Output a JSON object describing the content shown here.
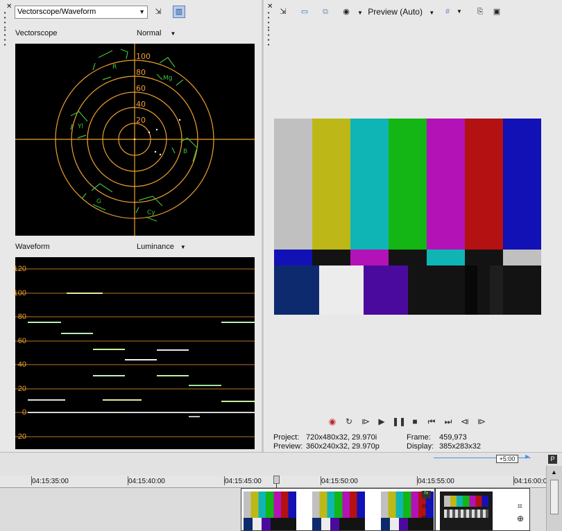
{
  "left_panel": {
    "scope_dropdown": "Vectorscope/Waveform",
    "vectorscope": {
      "label": "Vectorscope",
      "mode": "Normal",
      "ring_labels": [
        "100",
        "80",
        "60",
        "40",
        "20"
      ],
      "targets": [
        "R",
        "Mg",
        "B",
        "Cy",
        "G",
        "Yl"
      ]
    },
    "waveform": {
      "label": "Waveform",
      "mode": "Luminance",
      "axis_labels": [
        "120",
        "100",
        "80",
        "60",
        "40",
        "20",
        "0",
        "-20"
      ]
    }
  },
  "right_panel": {
    "preview_quality": "Preview (Auto)",
    "color_bars": [
      "#c0c0c0",
      "#bdb817",
      "#0fb5b5",
      "#13b614",
      "#b312b6",
      "#b41112",
      "#1111b5"
    ],
    "info": {
      "project_label": "Project:",
      "project_value": "720x480x32, 29.970i",
      "preview_label": "Preview:",
      "preview_value": "360x240x32, 29.970p",
      "frame_label": "Frame:",
      "frame_value": "459,973",
      "display_label": "Display:",
      "display_value": "385x283x32"
    }
  },
  "timeline": {
    "zoom_label": "+5:00",
    "timecodes": [
      "04:15:35:00",
      "04:15:40:00",
      "04:15:45:00",
      "04:15:50:00",
      "04:15:55:00",
      "04:16:00:0"
    ]
  },
  "colors": {
    "scope_accent": "#f0a030",
    "scope_target": "#3fc13f",
    "panel_bg": "#e8e8e8"
  }
}
